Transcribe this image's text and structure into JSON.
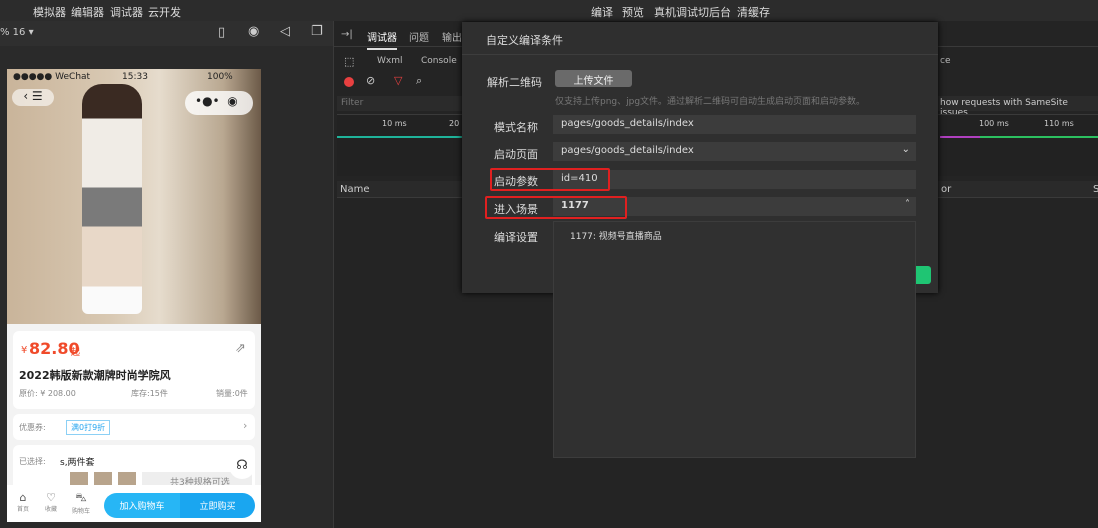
{
  "topbar": {
    "left_menu": [
      "模拟器",
      "编辑器",
      "调试器",
      "云开发"
    ],
    "right_menu": [
      "编译",
      "预览",
      "真机调试",
      "切后台",
      "清缓存"
    ]
  },
  "simulator": {
    "zoom_label": "% 16 ▾"
  },
  "phone": {
    "status": {
      "carrier": "●●●●● WeChat",
      "time": "15:33",
      "battery": "100%"
    },
    "price_symbol": "¥",
    "price": "82.80",
    "price_suffix": "起",
    "title": "2022韩版新款潮牌时尚学院风",
    "original_price": "原价: ¥ 208.00",
    "stock": "库存:15件",
    "sales": "销量:0件",
    "coupon_label": "优惠券:",
    "coupon_tag": "满0打9折",
    "selected_label": "已选择:",
    "selected_value": "s,两件套",
    "spec_count": "共3种规格可选",
    "nav": [
      {
        "icon": "home-icon",
        "label": "首页"
      },
      {
        "icon": "heart-icon",
        "label": "收藏"
      },
      {
        "icon": "cart-icon",
        "label": "购物车"
      }
    ],
    "add_cart": "加入购物车",
    "buy_now": "立即购买",
    "colors": {
      "price": "#f04a2a",
      "btn1": "#27b6f5",
      "btn2": "#1aa6f0"
    }
  },
  "devtools": {
    "tabs": [
      "调试器",
      "问题",
      "输出"
    ],
    "subtabs": [
      "Wxml",
      "Console"
    ],
    "subtab_right": "ce",
    "filter_placeholder": "Filter",
    "samesite": "how requests with SameSite issues",
    "timeline_ticks": [
      "10 ms",
      "20 m",
      "100 ms",
      "110 ms"
    ],
    "col_name": "Name",
    "col_or": "or",
    "col_s": "S"
  },
  "dialog": {
    "title": "自定义编译条件",
    "qr_label": "解析二维码",
    "upload_button": "上传文件",
    "qr_hint": "仅支持上传png、jpg文件。通过解析二维码可自动生成启动页面和启动参数。",
    "mode_label": "模式名称",
    "mode_value": "pages/goods_details/index",
    "page_label": "启动页面",
    "page_value": "pages/goods_details/index",
    "params_label": "启动参数",
    "params_value": "id=410",
    "scene_label": "进入场景",
    "scene_value": "1177",
    "compile_label": "编译设置",
    "scene_options": [
      "1177: 视频号直播商品"
    ],
    "accent": "#1fc573"
  }
}
